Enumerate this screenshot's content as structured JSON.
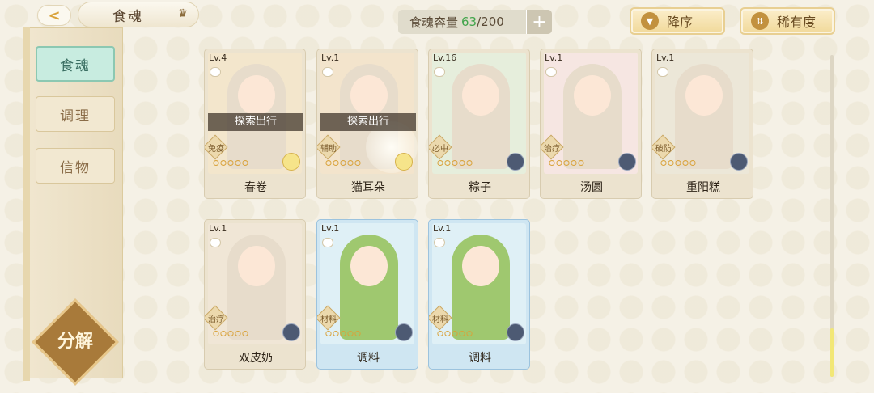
{
  "header": {
    "back_label": "<",
    "title": "食魂",
    "capacity_label": "食魂容量",
    "capacity_current": "63",
    "capacity_total": "/200",
    "plus_label": "+",
    "sort_order_label": "降序",
    "sort_field_label": "稀有度"
  },
  "sidebar": {
    "items": [
      {
        "label": "食魂"
      },
      {
        "label": "调理"
      },
      {
        "label": "信物"
      }
    ],
    "decompose_label": "分解"
  },
  "cards": [
    {
      "level": "Lv.4",
      "name": "春卷",
      "role": "免疫",
      "status": "探索出行",
      "stars": "⭘⭘⭘⭘⭘",
      "color": "#f3e6cc"
    },
    {
      "level": "Lv.1",
      "name": "猫耳朵",
      "role": "辅助",
      "status": "探索出行",
      "stars": "⭘⭘⭘⭘⭘",
      "color": "#f3e4cc"
    },
    {
      "level": "Lv.16",
      "name": "粽子",
      "role": "必中",
      "status": "",
      "stars": "⭘⭘⭘⭘⭘",
      "color": "#e6eedc"
    },
    {
      "level": "Lv.1",
      "name": "汤圆",
      "role": "治疗",
      "status": "",
      "stars": "⭘⭘⭘⭘⭘",
      "color": "#f6e6e2"
    },
    {
      "level": "Lv.1",
      "name": "重阳糕",
      "role": "破防",
      "status": "",
      "stars": "⭘⭘⭘⭘⭘",
      "color": "#ece7d8"
    },
    {
      "level": "Lv.1",
      "name": "双皮奶",
      "role": "治疗",
      "status": "",
      "stars": "⭘⭘⭘⭘⭘",
      "color": "#f0e6d6"
    },
    {
      "level": "Lv.1",
      "name": "调料",
      "role": "材料",
      "status": "",
      "stars": "⭘⭘⭘⭘⭘",
      "color": "#dff0f6"
    },
    {
      "level": "Lv.1",
      "name": "调料",
      "role": "材料",
      "status": "",
      "stars": "⭘⭘⭘⭘⭘",
      "color": "#dff0f6"
    }
  ]
}
